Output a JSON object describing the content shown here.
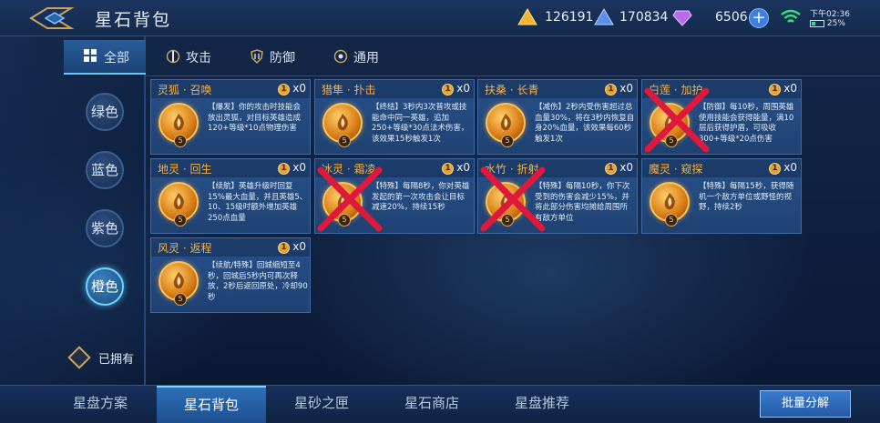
{
  "header": {
    "title": "星石背包",
    "gold": "126191",
    "coupon": "170834",
    "diamond": "6506",
    "plus": "+",
    "time": "下午02:36",
    "battery": "25%"
  },
  "category_tabs": [
    {
      "label": "全部",
      "icon": "grid-icon",
      "active": true
    },
    {
      "label": "攻击",
      "icon": "attack-icon"
    },
    {
      "label": "防御",
      "icon": "shield-icon"
    },
    {
      "label": "通用",
      "icon": "general-icon"
    }
  ],
  "color_filters": [
    {
      "label": "绿色"
    },
    {
      "label": "蓝色"
    },
    {
      "label": "紫色"
    },
    {
      "label": "橙色",
      "active": true
    }
  ],
  "owned_label": "已拥有",
  "cards": [
    {
      "name": "灵狐 · 召唤",
      "count_icon": "1",
      "count": "x0",
      "level": "5",
      "crossed": false,
      "desc": "【爆发】你的攻击时技能会放出灵狐，对目标英雄造成120+等级*10点物理伤害"
    },
    {
      "name": "猎隼 · 扑击",
      "count_icon": "1",
      "count": "x0",
      "level": "5",
      "crossed": false,
      "desc": "【终结】3秒内3次普攻或技能命中同一英雄，追加250+等级*30点法术伤害，该效果15秒触发1次"
    },
    {
      "name": "扶桑 · 长青",
      "count_icon": "1",
      "count": "x0",
      "level": "5",
      "crossed": false,
      "desc": "【减伤】2秒内受伤害超过总血量30%，将在3秒内恢复自身20%血量，该效果每60秒触发1次"
    },
    {
      "name": "白莲 · 加护",
      "count_icon": "1",
      "count": "x0",
      "level": "5",
      "crossed": true,
      "desc": "【防御】每10秒，周围英雄使用技能会获得能量，满10层后获得护盾，可吸收300+等级*20点伤害"
    },
    {
      "name": "地灵 · 回生",
      "count_icon": "1",
      "count": "x0",
      "level": "5",
      "crossed": false,
      "desc": "【续航】英雄升级时回复15%最大血量，并且英雄5、10、15级时额外增加英雄250点血量"
    },
    {
      "name": "冰灵 · 霜凌",
      "count_icon": "1",
      "count": "x0",
      "level": "5",
      "crossed": true,
      "desc": "【特殊】每隔8秒，你对英雄发起的第一次攻击会让目标减速20%，持续15秒"
    },
    {
      "name": "水竹 · 折射",
      "count_icon": "1",
      "count": "x0",
      "level": "5",
      "crossed": true,
      "desc": "【特殊】每隔10秒，你下次受到的伤害会减少15%，并将此部分伤害均摊给周围所有敌方单位"
    },
    {
      "name": "魔灵 · 窥探",
      "count_icon": "1",
      "count": "x0",
      "level": "5",
      "crossed": false,
      "desc": "【特殊】每隔15秒，获得随机一个敌方单位或野怪的视野，持续2秒"
    },
    {
      "name": "风灵 · 返程",
      "count_icon": "1",
      "count": "x0",
      "level": "5",
      "crossed": false,
      "desc": "【续航/特殊】回城缩短至4秒，回城后5秒内可再次释放，2秒后返回原处，冷却90秒"
    }
  ],
  "bottom_tabs": [
    {
      "label": "星盘方案"
    },
    {
      "label": "星石背包",
      "active": true
    },
    {
      "label": "星砂之匣"
    },
    {
      "label": "星石商店"
    },
    {
      "label": "星盘推荐"
    }
  ],
  "bulk_button": "批量分解",
  "colors": {
    "accent": "#63c7ff",
    "card_title": "#f3b24a",
    "cross": "#e0183c"
  }
}
